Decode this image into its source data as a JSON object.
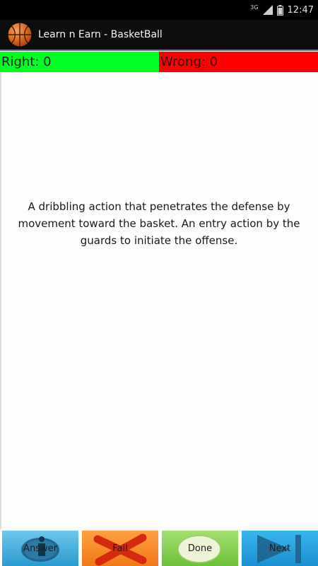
{
  "status_bar": {
    "network_label": "3G",
    "time": "12:47",
    "icons": [
      "signal-icon",
      "battery-icon"
    ]
  },
  "app": {
    "title": "Learn n Earn - BasketBall",
    "icon": "basketball-icon"
  },
  "score": {
    "right_label": "Right: 0",
    "wrong_label": "Wrong: 0",
    "colors": {
      "right": "#00ff22",
      "wrong": "#ff0000"
    }
  },
  "question": {
    "text": "A dribbling action that penetrates the defense by movement toward the basket. An entry action by the guards to initiate the offense."
  },
  "buttons": {
    "answer": {
      "label": "Answer",
      "icon": "info-icon",
      "color": "#2a9ad0"
    },
    "fail": {
      "label": "Fail",
      "icon": "x-mark-icon",
      "color": "#f07818"
    },
    "done": {
      "label": "Done",
      "icon": "oval-badge-icon",
      "color": "#6cc03a"
    },
    "next": {
      "label": "Next",
      "icon": "play-next-icon",
      "color": "#1a8fd0"
    }
  }
}
